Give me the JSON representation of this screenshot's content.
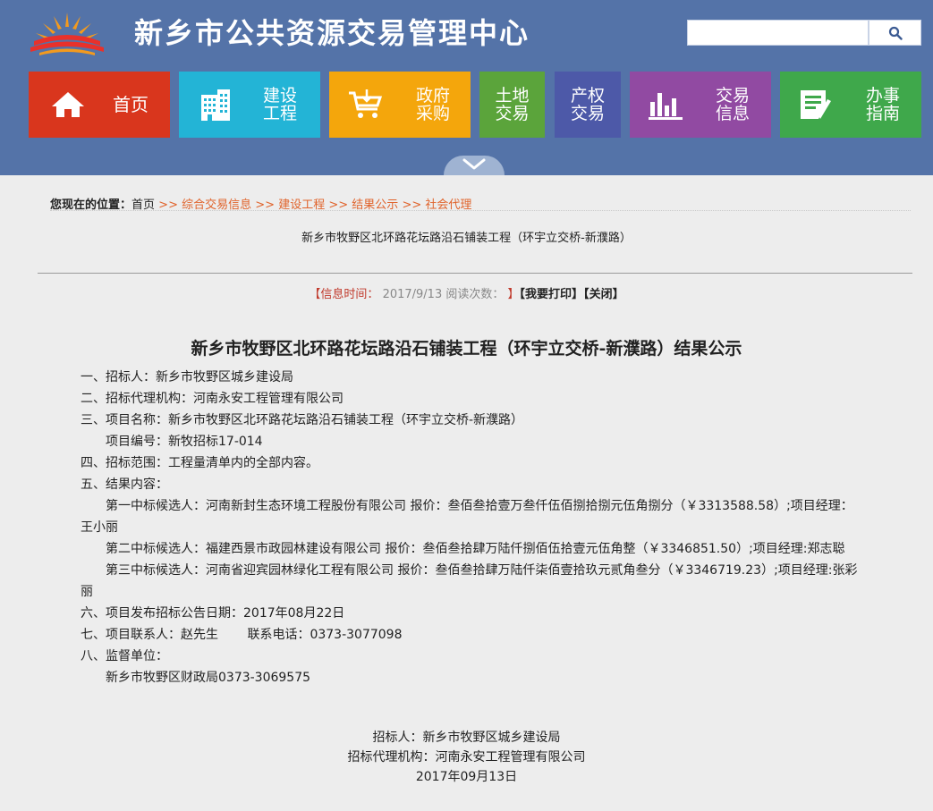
{
  "header": {
    "site_title": "新乡市公共资源交易管理中心",
    "search_placeholder": "",
    "colors": {
      "header_bg": "#5473a8"
    }
  },
  "nav": [
    {
      "label": "首页",
      "icon": "home-icon",
      "color": "#d9361d"
    },
    {
      "label": "建设工程",
      "icon": "building-icon",
      "color": "#23b4d6"
    },
    {
      "label": "政府采购",
      "icon": "cart-icon",
      "color": "#f4a60c"
    },
    {
      "label": "土地交易",
      "icon": "",
      "color": "#5ba43b"
    },
    {
      "label": "产权交易",
      "icon": "",
      "color": "#4d59a8"
    },
    {
      "label": "交易信息",
      "icon": "bar-chart-icon",
      "color": "#914aa2"
    },
    {
      "label": "办事指南",
      "icon": "document-icon",
      "color": "#3fa84b"
    }
  ],
  "breadcrumb": {
    "prefix": "您现在的位置：",
    "home": "首页",
    "separator": ">>",
    "items": [
      "综合交易信息",
      "建设工程",
      "结果公示",
      "社会代理"
    ]
  },
  "page_subtitle": "新乡市牧野区北环路花坛路沿石铺装工程（环宇立交桥-新濮路）",
  "meta": {
    "info_time_label": "【信息时间：",
    "info_time": "2017/9/13",
    "read_count_label": "阅读次数：",
    "read_count_close": "】",
    "print_label": "【我要打印】",
    "close_label": "【关闭】"
  },
  "article": {
    "title": "新乡市牧野区北环路花坛路沿石铺装工程（环宇立交桥-新濮路）结果公示",
    "lines": [
      "一、招标人：新乡市牧野区城乡建设局",
      "二、招标代理机构：河南永安工程管理有限公司",
      "三、项目名称：新乡市牧野区北环路花坛路沿石铺装工程（环宇立交桥-新濮路）",
      "项目编号：新牧招标17-014",
      "四、招标范围：工程量清单内的全部内容。",
      "五、结果内容：",
      "第一中标候选人：河南新封生态环境工程股份有限公司 报价：叁佰叁拾壹万叁仟伍佰捌拾捌元伍角捌分（￥3313588.58）;项目经理：王小丽",
      "第二中标候选人：福建西景市政园林建设有限公司 报价：叁佰叁拾肆万陆仟捌佰伍拾壹元伍角整（￥3346851.50）;项目经理:郑志聪",
      "第三中标候选人：河南省迎宾园林绿化工程有限公司 报价：叁佰叁拾肆万陆仟柒佰壹拾玖元贰角叁分（￥3346719.23）;项目经理:张彩丽",
      "六、项目发布招标公告日期：2017年08月22日",
      "七、项目联系人：赵先生　　 联系电话：0373-3077098",
      "八、监督单位：",
      "新乡市牧野区财政局0373-3069575"
    ],
    "signature": {
      "tenderer": "招标人：新乡市牧野区城乡建设局",
      "agent": "招标代理机构：河南永安工程管理有限公司",
      "date": "2017年09月13日"
    }
  }
}
